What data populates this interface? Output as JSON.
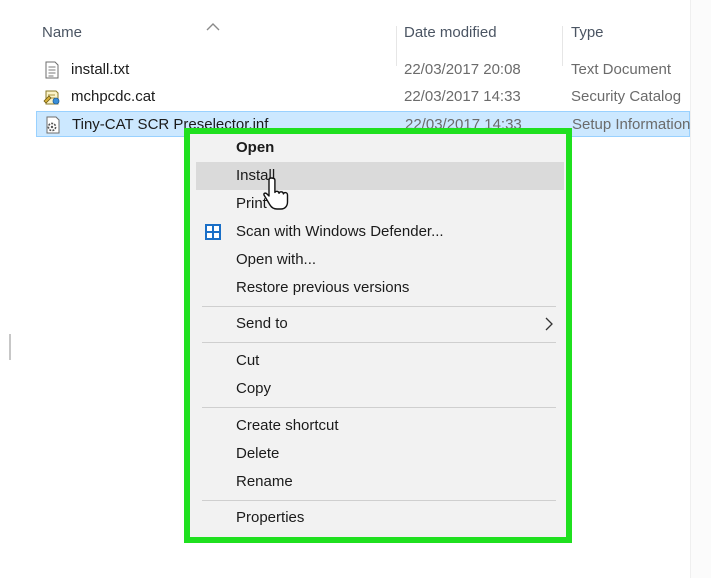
{
  "columns": {
    "name": "Name",
    "date_modified": "Date modified",
    "type": "Type"
  },
  "files": [
    {
      "name": "install.txt",
      "date": "22/03/2017 20:08",
      "type": "Text Document",
      "icon": "text-file-icon"
    },
    {
      "name": "mchpcdc.cat",
      "date": "22/03/2017 14:33",
      "type": "Security Catalog",
      "icon": "security-catalog-icon"
    },
    {
      "name": "Tiny-CAT SCR Preselector.inf",
      "date": "22/03/2017 14:33",
      "type": "Setup Information",
      "icon": "setup-information-icon",
      "selected": true
    }
  ],
  "context_menu": {
    "open": "Open",
    "install": "Install",
    "print": "Print",
    "scan": "Scan with Windows Defender...",
    "open_with": "Open with...",
    "restore": "Restore previous versions",
    "send_to": "Send to",
    "cut": "Cut",
    "copy": "Copy",
    "create_shortcut": "Create shortcut",
    "delete": "Delete",
    "rename": "Rename",
    "properties": "Properties",
    "hovered_item": "Install"
  },
  "colors": {
    "highlight_border": "#1fe01f",
    "selection": "#cce8ff",
    "menu_background": "#f2f2f2"
  }
}
